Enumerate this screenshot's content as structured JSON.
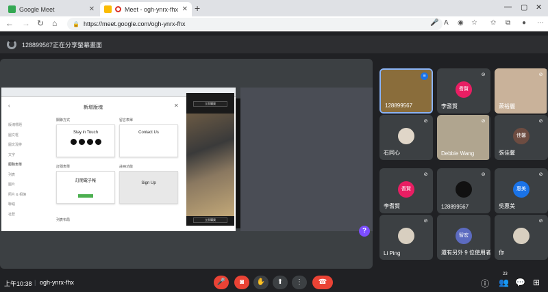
{
  "browser": {
    "tabs": [
      {
        "title": "Google Meet",
        "favicon_color": "#34a853"
      },
      {
        "title": "Meet - ogh-ynrx-fhx",
        "favicon_color": "#fbbc04"
      }
    ],
    "url": "https://meet.google.com/ogh-ynrx-fhx",
    "new_tab": "+"
  },
  "banner": {
    "text": "128899567正在分享螢幕畫面"
  },
  "shared_screen": {
    "modal_title": "新增版塊",
    "side_nav": [
      "版塊標題",
      "圖文框",
      "圖文混排",
      "文字",
      "服務表單",
      "列表",
      "圖片",
      "照片 & 相簿",
      "聯絡",
      "社群"
    ],
    "cards": {
      "social_label": "關聯方式",
      "stay_in_touch": "Stay in Touch",
      "contact_label": "留言表單",
      "contact_us": "Contact Us",
      "subscribe_label": "訂閱表單",
      "subscribe_title": "訂閱電子報",
      "signup_label": "註冊功能",
      "signup": "Sign Up",
      "list_label": "列表布局"
    },
    "phone_buttons": [
      "立即購買",
      "立即購買"
    ]
  },
  "participants": [
    {
      "name": "128899567",
      "avatar_text": "",
      "avatar_color": "#8a6d3b",
      "mic": "speaking",
      "active": true
    },
    {
      "name": "李耆賢",
      "avatar_text": "耆賢",
      "avatar_color": "#e91e63",
      "mic": "muted"
    },
    {
      "name": "萧裕麗",
      "avatar_text": "",
      "avatar_color": "#c9b29a",
      "mic": "muted"
    },
    {
      "name": "石同心",
      "avatar_text": "",
      "avatar_color": "#e0d6c8",
      "mic": "muted"
    },
    {
      "name": "Debbie Wang",
      "avatar_text": "",
      "avatar_color": "#b0a58f",
      "mic": "muted"
    },
    {
      "name": "張佳馨",
      "avatar_text": "佳馨",
      "avatar_color": "#6d4c41",
      "mic": "muted"
    },
    {
      "name": "李耆賢",
      "avatar_text": "耆賢",
      "avatar_color": "#e91e63",
      "mic": "muted"
    },
    {
      "name": "128899567",
      "avatar_text": "",
      "avatar_color": "#111111",
      "mic": "muted"
    },
    {
      "name": "吳惠美",
      "avatar_text": "惠美",
      "avatar_color": "#1a73e8",
      "mic": "muted"
    },
    {
      "name": "Li Ping",
      "avatar_text": "",
      "avatar_color": "#d8cfc0",
      "mic": "muted"
    },
    {
      "name": "還有另外 9 位使用者",
      "avatar_text": "智宏",
      "avatar_color": "#5c6bc0",
      "mic": ""
    },
    {
      "name": "你",
      "avatar_text": "",
      "avatar_color": "#d8cfc0",
      "mic": "muted"
    }
  ],
  "bottom": {
    "time": "上午10:38",
    "meeting_code": "ogh-ynrx-fhx",
    "participant_count": "23"
  },
  "colors": {
    "accent": "#8ab4f8",
    "danger": "#ea4335",
    "surface": "#3c4043",
    "bg": "#202124"
  }
}
